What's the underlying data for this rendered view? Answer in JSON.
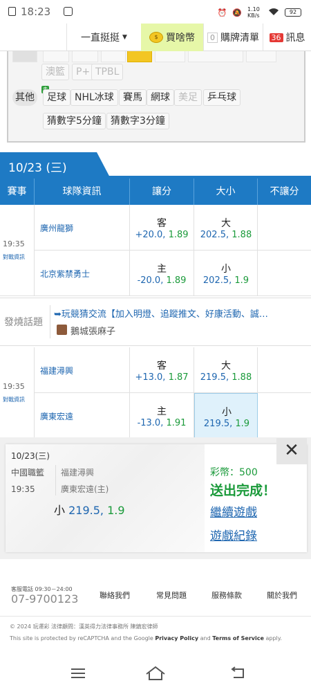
{
  "status_bar": {
    "time": "18:23",
    "net_speed": "1.10 KB/s",
    "battery": "92"
  },
  "top_nav": {
    "menu_label": "一直挺挺",
    "coin_label": "買啥幣",
    "cart_label": "購牌清單",
    "cart_count": "0",
    "msg_label": "訊息",
    "msg_count": "36"
  },
  "filter": {
    "row1": [
      "澳籃",
      "P+",
      "TPBL"
    ],
    "other_label": "其他",
    "new_badge": "走",
    "row2": [
      "足球",
      "NHL冰球",
      "賽馬",
      "網球",
      "美足",
      "乒乓球"
    ],
    "row3": [
      "猜數字5分鐘",
      "猜數字3分鐘"
    ]
  },
  "date_tab": "10/23 (三)",
  "table_header": [
    "賽事",
    "球隊資訊",
    "讓分",
    "大小",
    "不讓分"
  ],
  "matches": [
    {
      "time": "19:35",
      "info": "對戰資訊",
      "home": {
        "team": "廣州龍獅",
        "spread_side": "客",
        "spread": "+20.0,",
        "spread_odds": "1.89",
        "ou_side": "大",
        "ou": "202.5,",
        "ou_odds": "1.88"
      },
      "away": {
        "team": "北京紫禁勇士",
        "spread_side": "主",
        "spread": "-20.0,",
        "spread_odds": "1.89",
        "ou_side": "小",
        "ou": "202.5,",
        "ou_odds": "1.9"
      }
    },
    {
      "time": "19:35",
      "info": "對戰資訊",
      "home": {
        "team": "福建潯興",
        "spread_side": "客",
        "spread": "+13.0,",
        "spread_odds": "1.87",
        "ou_side": "大",
        "ou": "219.5,",
        "ou_odds": "1.88"
      },
      "away": {
        "team": "廣東宏遠",
        "spread_side": "主",
        "spread": "-13.0,",
        "spread_odds": "1.91",
        "ou_side": "小",
        "ou": "219.5,",
        "ou_odds": "1.9"
      }
    }
  ],
  "topic": {
    "label": "發燒話題",
    "headline": "➥玩競猜交流【加入明燈、追蹤推文、好康活動、誠…",
    "author": "鵝城張麻子"
  },
  "bet_slip": {
    "date": "10/23(三)",
    "league": "中國職籃",
    "time": "19:35",
    "team1": "福建潯興",
    "team2": "廣東宏遠(主)",
    "pick_side": "小",
    "pick_line": "219.5,",
    "pick_odds": "1.9",
    "coin_text": "彩幣：500",
    "sent_text": "送出完成！",
    "continue_link": "繼續遊戲",
    "records_link": "遊戲紀錄",
    "close": "✕"
  },
  "footer": {
    "hotline_label": "客服電話 09:30－24:00",
    "hotline": "07-9700123",
    "links": [
      "聯絡我們",
      "常見問題",
      "服務條款",
      "關於我們"
    ],
    "copyright": "© 2024  玩運彩  法律顧問：漢英得力法律事務所 陳鎮宏律師",
    "recaptcha_prefix": "This site is protected by reCAPTCHA and the Google",
    "privacy": "Privacy Policy",
    "and": "and",
    "terms": "Terms of Service",
    "apply": "apply."
  },
  "colors": {
    "primary": "#1e7ac4",
    "green": "#1a9a3a",
    "coin_bg": "#e6f7a8",
    "badge_red": "#e53935"
  }
}
